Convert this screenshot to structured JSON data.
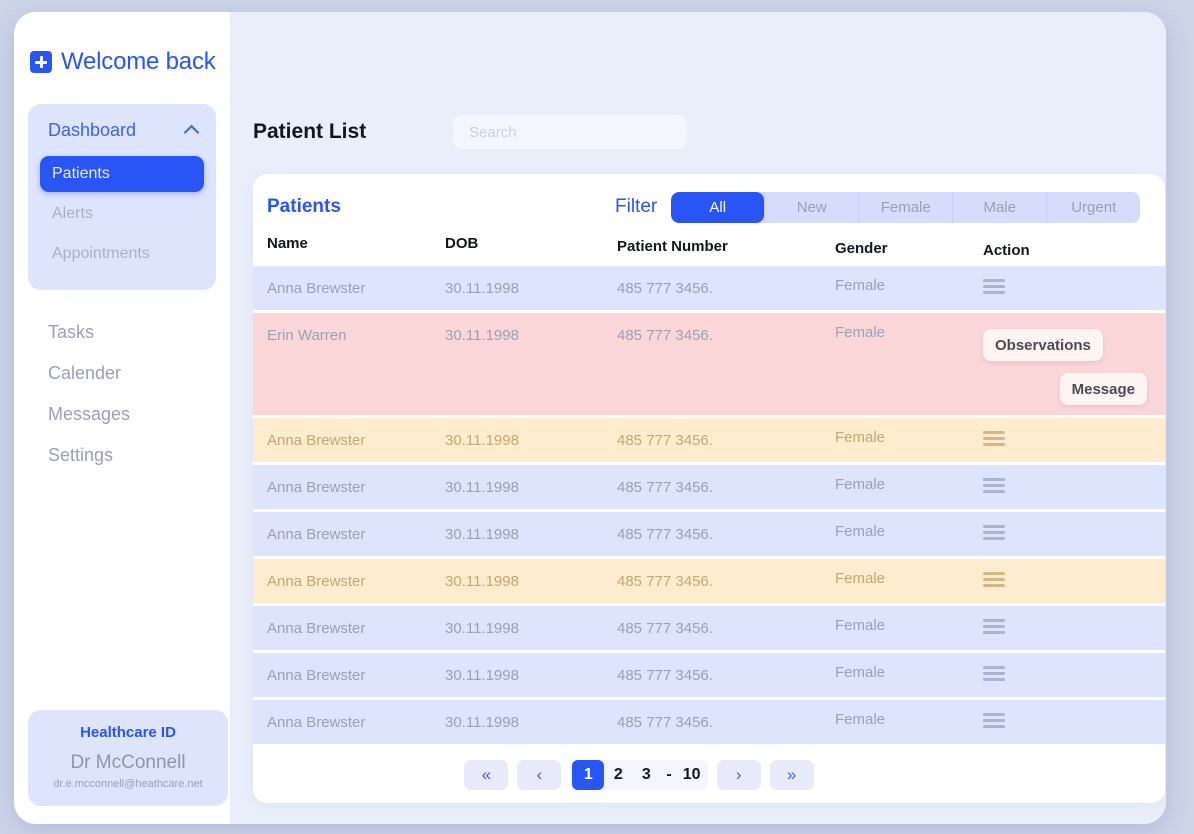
{
  "brand": {
    "logo_icon": "plus-icon",
    "title": "Welcome back"
  },
  "sidebar": {
    "group": {
      "title": "Dashboard",
      "chevron_icon": "chevron-up-icon",
      "items": [
        {
          "label": "Patients",
          "active": true
        },
        {
          "label": "Alerts",
          "active": false
        },
        {
          "label": "Appointments",
          "active": false
        }
      ]
    },
    "main_items": [
      {
        "label": "Tasks"
      },
      {
        "label": "Calender"
      },
      {
        "label": "Messages"
      },
      {
        "label": "Settings"
      }
    ],
    "id_card": {
      "title": "Healthcare ID",
      "name": "Dr McConnell",
      "email": "dr.e.mcconnell@heathcare.net"
    }
  },
  "header": {
    "page_title": "Patient List",
    "search_placeholder": "Search",
    "search_value": ""
  },
  "table": {
    "title": "Patients",
    "filter_label": "Filter",
    "filters": [
      {
        "label": "All",
        "active": true
      },
      {
        "label": "New",
        "active": false
      },
      {
        "label": "Female",
        "active": false
      },
      {
        "label": "Male",
        "active": false
      },
      {
        "label": "Urgent",
        "active": false
      }
    ],
    "columns": [
      "Name",
      "DOB",
      "Patient Number",
      "Gender",
      "Action"
    ],
    "rows": [
      {
        "name": "Anna Brewster",
        "dob": "30.11.1998",
        "number": "485 777 3456.",
        "gender": "Female",
        "tone": "blue",
        "action": "menu"
      },
      {
        "name": "Erin Warren",
        "dob": "30.11.1998",
        "number": "485 777 3456.",
        "gender": "Female",
        "tone": "pink",
        "action": "buttons",
        "buttons": [
          "Observations",
          "Message"
        ]
      },
      {
        "name": "Anna Brewster",
        "dob": "30.11.1998",
        "number": "485 777 3456.",
        "gender": "Female",
        "tone": "amber",
        "action": "menu"
      },
      {
        "name": "Anna Brewster",
        "dob": "30.11.1998",
        "number": "485 777 3456.",
        "gender": "Female",
        "tone": "blue",
        "action": "menu"
      },
      {
        "name": "Anna Brewster",
        "dob": "30.11.1998",
        "number": "485 777 3456.",
        "gender": "Female",
        "tone": "blue",
        "action": "menu"
      },
      {
        "name": "Anna Brewster",
        "dob": "30.11.1998",
        "number": "485 777 3456.",
        "gender": "Female",
        "tone": "amber",
        "action": "menu"
      },
      {
        "name": "Anna Brewster",
        "dob": "30.11.1998",
        "number": "485 777 3456.",
        "gender": "Female",
        "tone": "blue",
        "action": "menu"
      },
      {
        "name": "Anna Brewster",
        "dob": "30.11.1998",
        "number": "485 777 3456.",
        "gender": "Female",
        "tone": "blue",
        "action": "menu"
      },
      {
        "name": "Anna Brewster",
        "dob": "30.11.1998",
        "number": "485 777 3456.",
        "gender": "Female",
        "tone": "blue",
        "action": "menu"
      }
    ]
  },
  "pagination": {
    "first_icon": "double-chevron-left-icon",
    "prev_icon": "chevron-left-icon",
    "next_icon": "chevron-right-icon",
    "last_icon": "double-chevron-right-icon",
    "first_label": "«",
    "prev_label": "‹",
    "next_label": "›",
    "last_label": "»",
    "pages": [
      "1",
      "2",
      "3"
    ],
    "separator": "-",
    "last_page": "10",
    "current": "1"
  },
  "colors": {
    "accent": "#2a55f5",
    "row_blue": "#dde4fb",
    "row_amber": "#fdeccd",
    "row_pink": "#fbd6d9",
    "canvas": "#ccd4e8",
    "content_bg": "#eaeefb"
  }
}
